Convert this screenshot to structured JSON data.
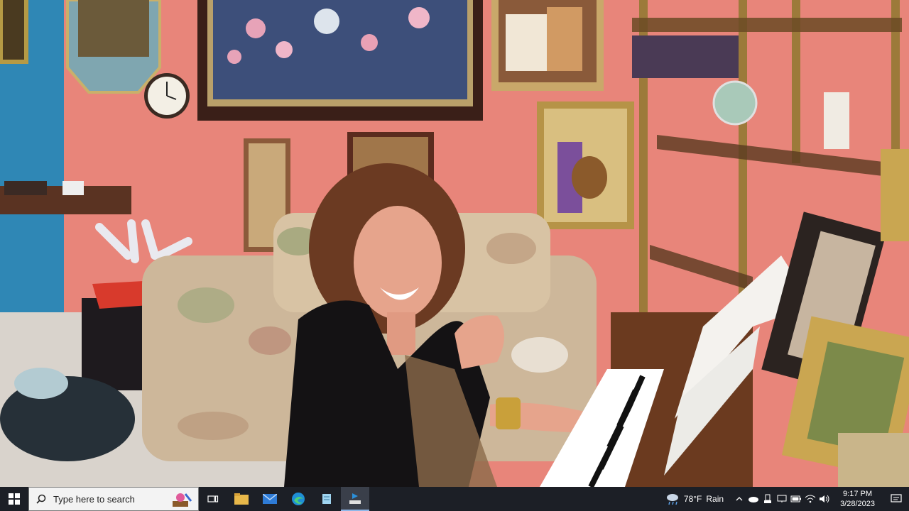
{
  "taskbar": {
    "search_placeholder": "Type here to search",
    "weather": {
      "temperature": "78°F",
      "condition": "Rain",
      "icon": "cloud-rain-icon"
    },
    "clock": {
      "time": "9:17 PM",
      "date": "3/28/2023"
    },
    "pinned_apps": [
      "task-view-icon",
      "file-explorer-icon",
      "mail-icon",
      "edge-icon",
      "notepad-icon",
      "camera-app-icon"
    ],
    "tray_icons": [
      "chevron-up-icon",
      "onedrive-icon",
      "usb-icon",
      "display-icon",
      "battery-icon",
      "wifi-icon",
      "volume-icon"
    ]
  },
  "colors": {
    "wall": "#e8857a",
    "wall_blue": "#2f87b5",
    "taskbar": "#1c1f26",
    "sofa": "#cdb79a",
    "piano": "#6b3a1f"
  }
}
